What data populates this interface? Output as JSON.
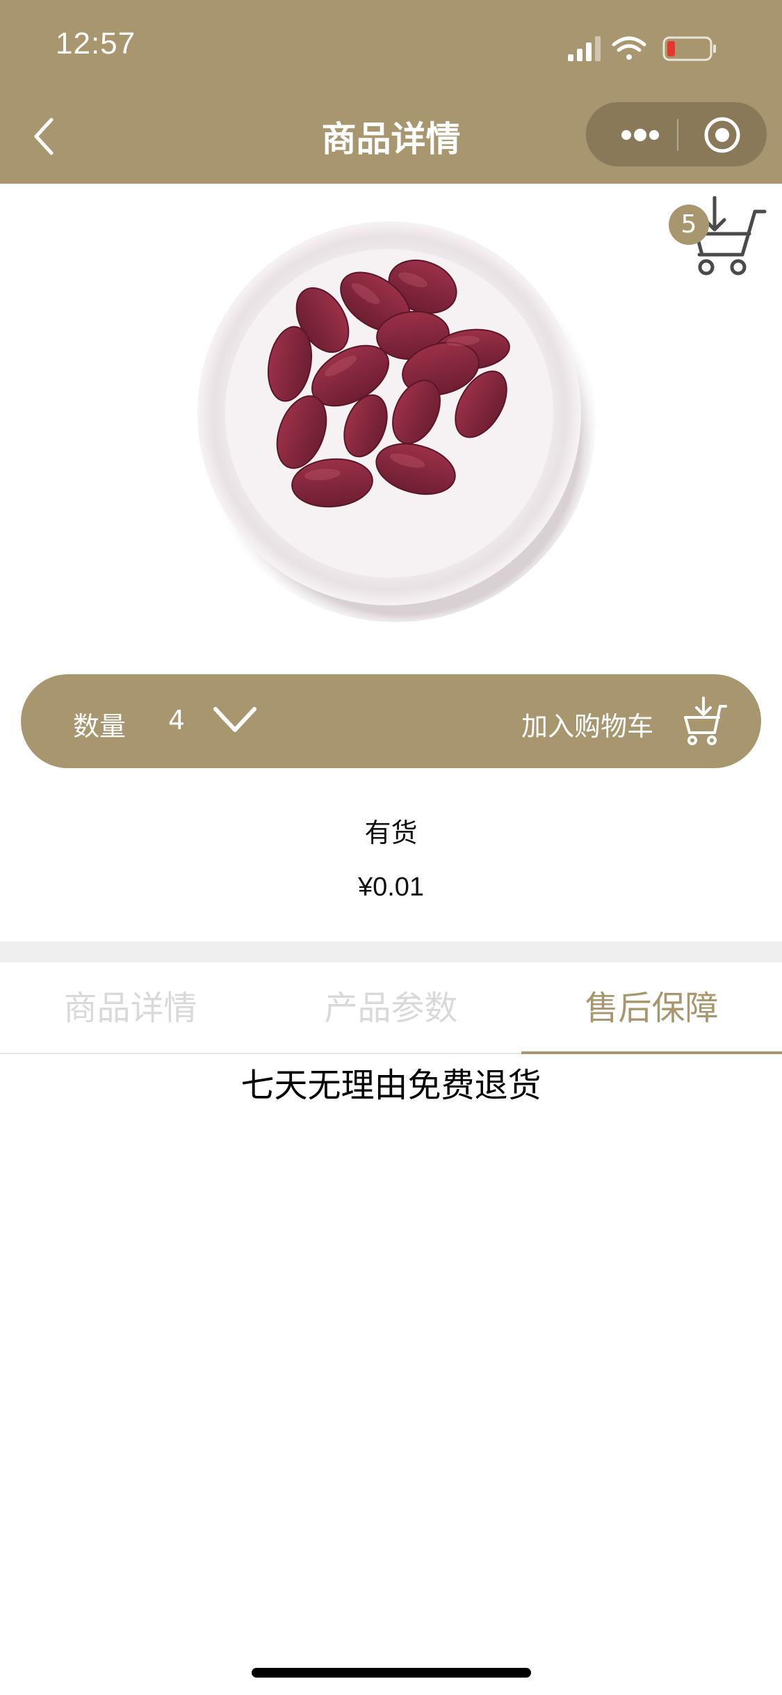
{
  "status_bar": {
    "time": "12:57"
  },
  "nav": {
    "title": "商品详情"
  },
  "cart": {
    "badge_count": "5"
  },
  "action_bar": {
    "quantity_label": "数量",
    "quantity_value": "4",
    "add_to_cart_label": "加入购物车"
  },
  "product": {
    "stock_status": "有货",
    "price": "¥0.01"
  },
  "tabs": [
    {
      "label": "商品详情",
      "active": false
    },
    {
      "label": "产品参数",
      "active": false
    },
    {
      "label": "售后保障",
      "active": true
    }
  ],
  "tab_content": {
    "text": "七天无理由免费退货"
  },
  "colors": {
    "brand": "#a8966f",
    "inactive_tab": "#d9d9d9",
    "divider": "#efefef"
  },
  "icons": [
    "back-icon",
    "more-icon",
    "target-icon",
    "cart-download-icon",
    "chevron-down-icon",
    "cart-add-icon",
    "signal-icon",
    "wifi-icon",
    "battery-icon"
  ]
}
